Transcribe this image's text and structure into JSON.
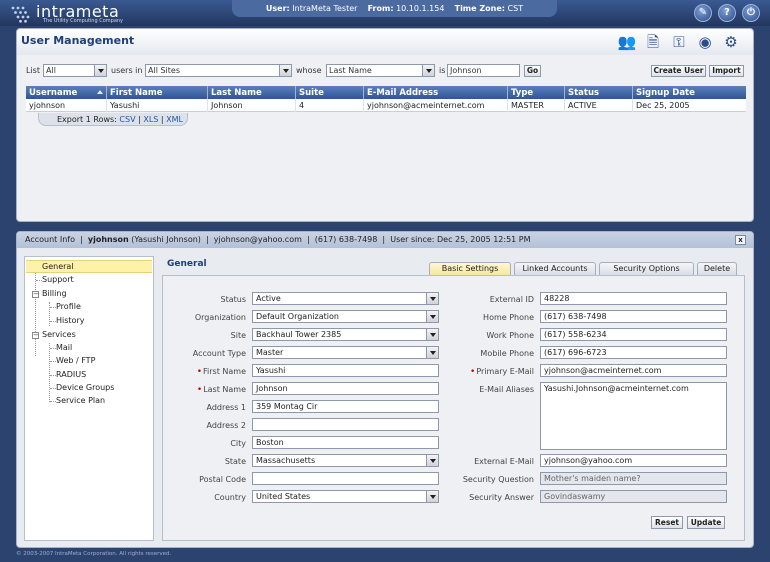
{
  "brand": {
    "name": "intrameta",
    "tagline": "The Utility Computing Company"
  },
  "session": {
    "user_label": "User:",
    "user": "IntraMeta Tester",
    "from_label": "From:",
    "ip": "10.10.1.154",
    "tz_label": "Time Zone:",
    "tz": "CST"
  },
  "top_icons": [
    {
      "name": "tools-icon",
      "glyph": "✎"
    },
    {
      "name": "help-icon",
      "glyph": "?"
    },
    {
      "name": "power-icon",
      "glyph": "⏻"
    }
  ],
  "page_title": "User Management",
  "head_icons": [
    {
      "name": "users-icon",
      "glyph": "👥"
    },
    {
      "name": "document-icon",
      "glyph": "🗎"
    },
    {
      "name": "network-icon",
      "glyph": "⚿"
    },
    {
      "name": "globe-icon",
      "glyph": "◉"
    },
    {
      "name": "settings-icon",
      "glyph": "⚙"
    }
  ],
  "filter": {
    "list_label": "List",
    "list_value": "All",
    "users_in_label": "users in",
    "sites_value": "All Sites",
    "whose_label": "whose",
    "field_value": "Last Name",
    "is_label": "is",
    "search_value": "Johnson",
    "go_label": "Go",
    "create_label": "Create User",
    "import_label": "Import"
  },
  "grid": {
    "columns": [
      "Username",
      "First Name",
      "Last Name",
      "Suite",
      "E-Mail Address",
      "Type",
      "Status",
      "Signup Date"
    ],
    "rows": [
      [
        "yjohnson",
        "Yasushi",
        "Johnson",
        "4",
        "yjohnson@acmeinternet.com",
        "MASTER",
        "ACTIVE",
        "Dec 25, 2005"
      ]
    ],
    "export_label": "Export 1 Rows:",
    "export_csv": "CSV",
    "export_xls": "XLS",
    "export_xml": "XML"
  },
  "account": {
    "label": "Account Info",
    "username": "yjohnson",
    "fullname": "(Yasushi Johnson)",
    "email": "yjohnson@yahoo.com",
    "phone": "(617) 638-7498",
    "since": "User since: Dec 25, 2005 12:51 PM",
    "close_label": "x"
  },
  "tree": {
    "general": "General",
    "support": "Support",
    "billing": "Billing",
    "profile": "Profile",
    "history": "History",
    "services": "Services",
    "mail": "Mail",
    "web_ftp": "Web / FTP",
    "radius": "RADIUS",
    "device_groups": "Device Groups",
    "service_plan": "Service Plan",
    "toggle": "−"
  },
  "section_title": "General",
  "tabs": [
    "Basic Settings",
    "Linked Accounts",
    "Security Options",
    "Delete"
  ],
  "form": {
    "status": {
      "label": "Status",
      "value": "Active"
    },
    "organization": {
      "label": "Organization",
      "value": "Default Organization"
    },
    "site": {
      "label": "Site",
      "value": "Backhaul Tower 2385"
    },
    "account_type": {
      "label": "Account Type",
      "value": "Master"
    },
    "first_name": {
      "label": "First Name",
      "value": "Yasushi"
    },
    "last_name": {
      "label": "Last Name",
      "value": "Johnson"
    },
    "address1": {
      "label": "Address 1",
      "value": "359 Montag Cir"
    },
    "address2": {
      "label": "Address 2",
      "value": ""
    },
    "city": {
      "label": "City",
      "value": "Boston"
    },
    "state": {
      "label": "State",
      "value": "Massachusetts"
    },
    "postal": {
      "label": "Postal Code",
      "value": ""
    },
    "country": {
      "label": "Country",
      "value": "United States"
    },
    "external_id": {
      "label": "External ID",
      "value": "48228"
    },
    "home_phone": {
      "label": "Home Phone",
      "value": "(617) 638-7498"
    },
    "work_phone": {
      "label": "Work Phone",
      "value": "(617) 558-6234"
    },
    "mobile_phone": {
      "label": "Mobile Phone",
      "value": "(617) 696-6723"
    },
    "primary_email": {
      "label": "Primary E-Mail",
      "value": "yjohnson@acmeinternet.com"
    },
    "aliases": {
      "label": "E-Mail Aliases",
      "value": "Yasushi.Johnson@acmeinternet.com"
    },
    "external_email": {
      "label": "External E-Mail",
      "value": "yjohnson@yahoo.com"
    },
    "security_question": {
      "label": "Security Question",
      "value": "Mother's maiden name?"
    },
    "security_answer": {
      "label": "Security Answer",
      "value": "Govindaswamy"
    },
    "reset_label": "Reset",
    "update_label": "Update"
  },
  "footer": "© 2003-2007 IntraMeta Corporation.  All rights reserved."
}
